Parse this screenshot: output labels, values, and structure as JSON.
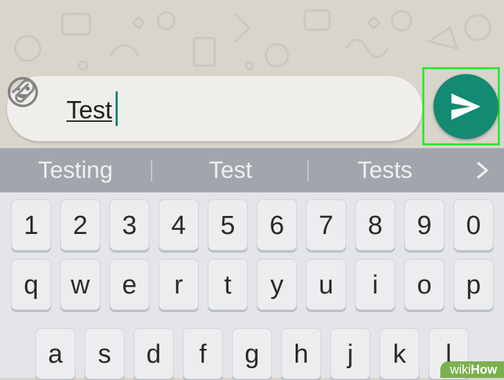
{
  "chat": {
    "message_text": "Test"
  },
  "suggestions": [
    "Testing",
    "Test",
    "Tests"
  ],
  "keyboard": {
    "number_row": [
      "1",
      "2",
      "3",
      "4",
      "5",
      "6",
      "7",
      "8",
      "9",
      "0"
    ],
    "letter_row_1": [
      "q",
      "w",
      "e",
      "r",
      "t",
      "y",
      "u",
      "i",
      "o",
      "p"
    ],
    "letter_row_2": [
      "a",
      "s",
      "d",
      "f",
      "g",
      "h",
      "j",
      "k",
      "l"
    ]
  },
  "icons": {
    "emoji": "emoji-icon",
    "attach": "paperclip-icon",
    "send": "send-icon",
    "more_suggestions": "chevron-right-icon"
  },
  "colors": {
    "send_button": "#138a72",
    "highlight": "#2ee82e",
    "cursor": "#0b7f70"
  },
  "watermark": {
    "prefix": "wiki",
    "suffix": "How"
  }
}
